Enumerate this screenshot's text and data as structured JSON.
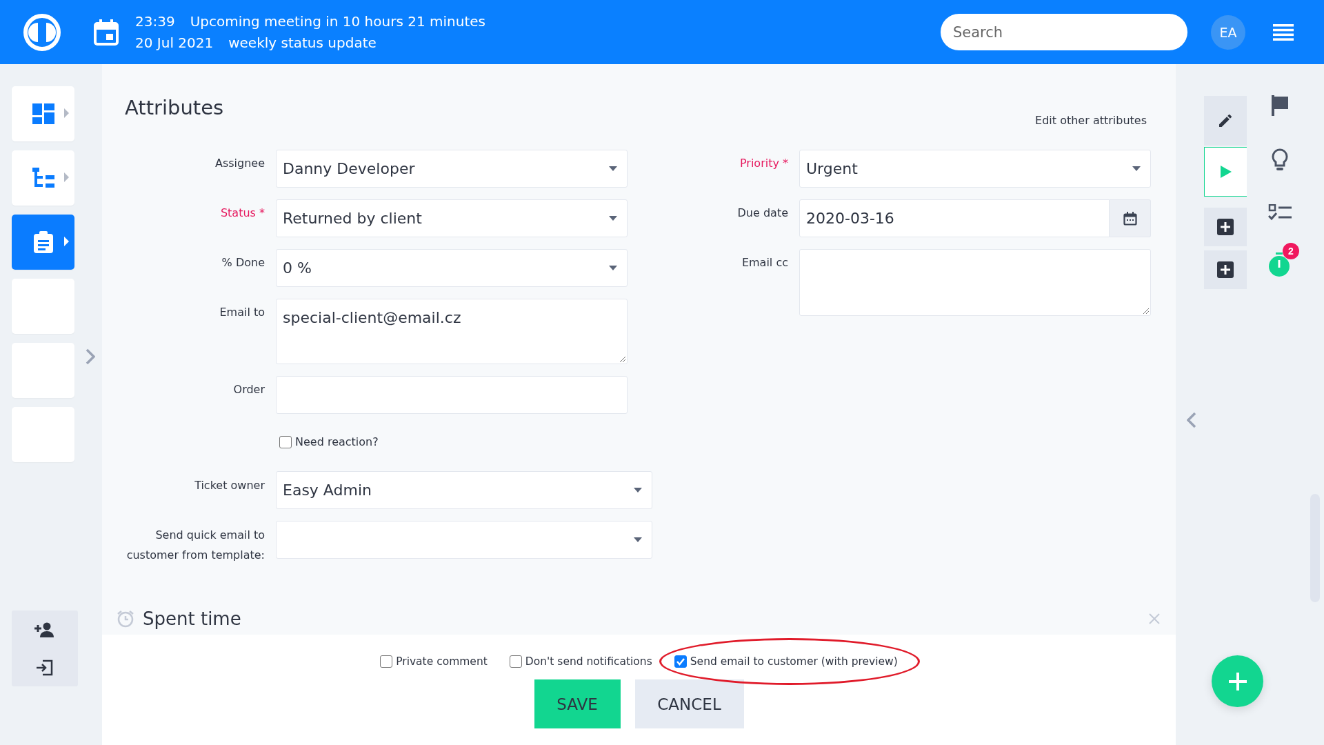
{
  "topbar": {
    "meeting_time": "23:39",
    "meeting_text": "Upcoming meeting in 10 hours 21 minutes",
    "meeting_date": "20 Jul 2021",
    "meeting_title": "weekly status update",
    "search": {
      "placeholder": "Search"
    },
    "avatar": "EA"
  },
  "sidebar": {
    "items": [
      {
        "kind": "dashboard",
        "selected": false
      },
      {
        "kind": "tree",
        "selected": false
      },
      {
        "kind": "clipboard",
        "selected": true
      },
      {
        "kind": "empty",
        "selected": false
      },
      {
        "kind": "empty",
        "selected": false
      },
      {
        "kind": "empty",
        "selected": false
      }
    ],
    "footer_actions": [
      {
        "kind": "add-user"
      },
      {
        "kind": "sign-in"
      }
    ]
  },
  "attributes": {
    "title": "Attributes",
    "edit_link": "Edit other attributes",
    "left_fields": [
      {
        "label": "Assignee",
        "required": false,
        "kind": "select",
        "value": "Danny Developer"
      },
      {
        "label": "Status *",
        "required": true,
        "kind": "select",
        "value": "Returned by client"
      },
      {
        "label": "% Done",
        "required": false,
        "kind": "select",
        "value": "0 %"
      },
      {
        "label": "Email to",
        "required": false,
        "kind": "textarea",
        "value": "special-client@email.cz"
      },
      {
        "label": "Order",
        "required": false,
        "kind": "text"
      },
      {
        "label": "Need reaction?",
        "kind": "checkbox",
        "checked": false
      }
    ],
    "owner_fields": [
      {
        "label": "Ticket owner",
        "required": false,
        "kind": "select",
        "value": "Easy Admin"
      },
      {
        "label": "Send quick email to customer from template:",
        "required": false,
        "kind": "select"
      }
    ],
    "right_fields": [
      {
        "label": "Priority *",
        "required": true,
        "kind": "select",
        "value": "Urgent"
      },
      {
        "label": "Due date",
        "required": false,
        "kind": "date",
        "value": "2020-03-16"
      },
      {
        "label": "Email cc",
        "required": false,
        "kind": "textarea"
      }
    ]
  },
  "spent_time": {
    "title": "Spent time"
  },
  "footer": {
    "options": [
      {
        "label": "Private comment",
        "checked": false,
        "highlighted": false
      },
      {
        "label": "Don't send notifications",
        "checked": false,
        "highlighted": false
      },
      {
        "label": "Send email to customer (with preview)",
        "checked": true,
        "highlighted": true
      }
    ],
    "buttons": [
      {
        "label": "SAVE",
        "kind": "primary"
      },
      {
        "label": "CANCEL",
        "kind": "secondary"
      }
    ]
  },
  "right_rail": {
    "actions": [
      {
        "kind": "edit"
      },
      {
        "kind": "play"
      },
      {
        "kind": "add"
      },
      {
        "kind": "add"
      }
    ],
    "tools": [
      {
        "kind": "flag"
      },
      {
        "kind": "bulb"
      },
      {
        "kind": "checklist"
      },
      {
        "kind": "timer",
        "badge": "2"
      }
    ]
  }
}
